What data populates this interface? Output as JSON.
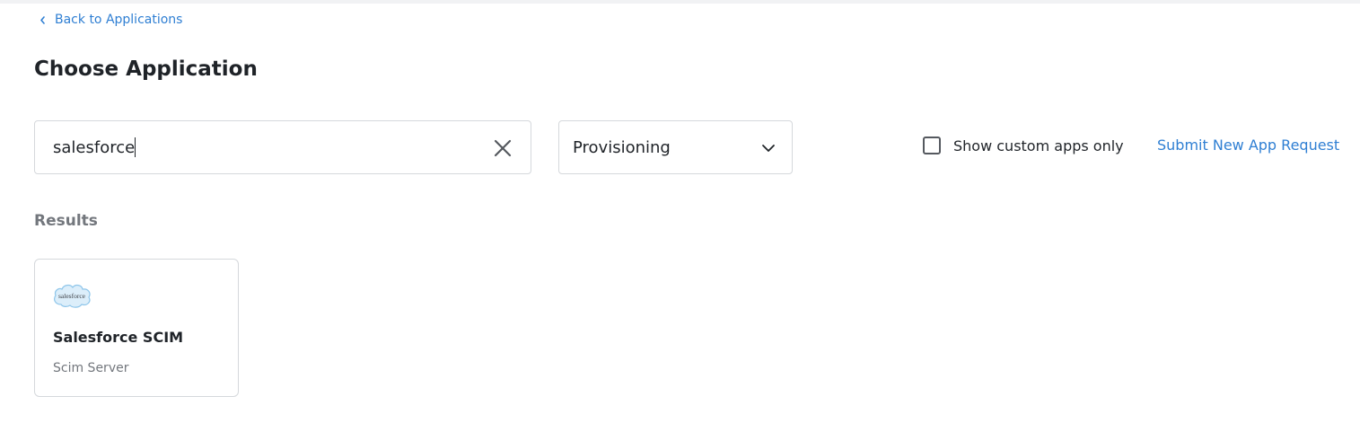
{
  "nav": {
    "back_label": "Back to Applications"
  },
  "page": {
    "title": "Choose Application"
  },
  "search": {
    "value": "salesforce"
  },
  "filter": {
    "selected": "Provisioning"
  },
  "custom_apps": {
    "label": "Show custom apps only",
    "checked": false
  },
  "submit_request": {
    "label": "Submit New App Request"
  },
  "results": {
    "heading": "Results",
    "items": [
      {
        "name": "Salesforce SCIM",
        "type": "Scim Server",
        "logo_text": "salesforce",
        "icon": "salesforce-cloud-logo"
      }
    ]
  },
  "colors": {
    "accent": "#2f7fd3",
    "text": "#1f2328",
    "muted": "#73777d",
    "border": "#d5d8dc"
  }
}
